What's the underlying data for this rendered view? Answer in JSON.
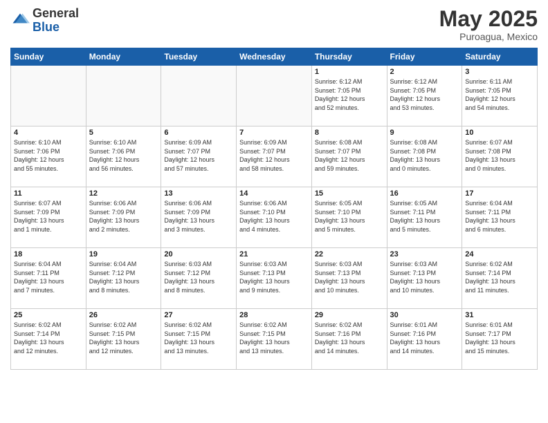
{
  "header": {
    "logo_general": "General",
    "logo_blue": "Blue",
    "title": "May 2025",
    "location": "Puroagua, Mexico"
  },
  "weekdays": [
    "Sunday",
    "Monday",
    "Tuesday",
    "Wednesday",
    "Thursday",
    "Friday",
    "Saturday"
  ],
  "weeks": [
    [
      {
        "day": "",
        "info": ""
      },
      {
        "day": "",
        "info": ""
      },
      {
        "day": "",
        "info": ""
      },
      {
        "day": "",
        "info": ""
      },
      {
        "day": "1",
        "info": "Sunrise: 6:12 AM\nSunset: 7:05 PM\nDaylight: 12 hours\nand 52 minutes."
      },
      {
        "day": "2",
        "info": "Sunrise: 6:12 AM\nSunset: 7:05 PM\nDaylight: 12 hours\nand 53 minutes."
      },
      {
        "day": "3",
        "info": "Sunrise: 6:11 AM\nSunset: 7:05 PM\nDaylight: 12 hours\nand 54 minutes."
      }
    ],
    [
      {
        "day": "4",
        "info": "Sunrise: 6:10 AM\nSunset: 7:06 PM\nDaylight: 12 hours\nand 55 minutes."
      },
      {
        "day": "5",
        "info": "Sunrise: 6:10 AM\nSunset: 7:06 PM\nDaylight: 12 hours\nand 56 minutes."
      },
      {
        "day": "6",
        "info": "Sunrise: 6:09 AM\nSunset: 7:07 PM\nDaylight: 12 hours\nand 57 minutes."
      },
      {
        "day": "7",
        "info": "Sunrise: 6:09 AM\nSunset: 7:07 PM\nDaylight: 12 hours\nand 58 minutes."
      },
      {
        "day": "8",
        "info": "Sunrise: 6:08 AM\nSunset: 7:07 PM\nDaylight: 12 hours\nand 59 minutes."
      },
      {
        "day": "9",
        "info": "Sunrise: 6:08 AM\nSunset: 7:08 PM\nDaylight: 13 hours\nand 0 minutes."
      },
      {
        "day": "10",
        "info": "Sunrise: 6:07 AM\nSunset: 7:08 PM\nDaylight: 13 hours\nand 0 minutes."
      }
    ],
    [
      {
        "day": "11",
        "info": "Sunrise: 6:07 AM\nSunset: 7:09 PM\nDaylight: 13 hours\nand 1 minute."
      },
      {
        "day": "12",
        "info": "Sunrise: 6:06 AM\nSunset: 7:09 PM\nDaylight: 13 hours\nand 2 minutes."
      },
      {
        "day": "13",
        "info": "Sunrise: 6:06 AM\nSunset: 7:09 PM\nDaylight: 13 hours\nand 3 minutes."
      },
      {
        "day": "14",
        "info": "Sunrise: 6:06 AM\nSunset: 7:10 PM\nDaylight: 13 hours\nand 4 minutes."
      },
      {
        "day": "15",
        "info": "Sunrise: 6:05 AM\nSunset: 7:10 PM\nDaylight: 13 hours\nand 5 minutes."
      },
      {
        "day": "16",
        "info": "Sunrise: 6:05 AM\nSunset: 7:11 PM\nDaylight: 13 hours\nand 5 minutes."
      },
      {
        "day": "17",
        "info": "Sunrise: 6:04 AM\nSunset: 7:11 PM\nDaylight: 13 hours\nand 6 minutes."
      }
    ],
    [
      {
        "day": "18",
        "info": "Sunrise: 6:04 AM\nSunset: 7:11 PM\nDaylight: 13 hours\nand 7 minutes."
      },
      {
        "day": "19",
        "info": "Sunrise: 6:04 AM\nSunset: 7:12 PM\nDaylight: 13 hours\nand 8 minutes."
      },
      {
        "day": "20",
        "info": "Sunrise: 6:03 AM\nSunset: 7:12 PM\nDaylight: 13 hours\nand 8 minutes."
      },
      {
        "day": "21",
        "info": "Sunrise: 6:03 AM\nSunset: 7:13 PM\nDaylight: 13 hours\nand 9 minutes."
      },
      {
        "day": "22",
        "info": "Sunrise: 6:03 AM\nSunset: 7:13 PM\nDaylight: 13 hours\nand 10 minutes."
      },
      {
        "day": "23",
        "info": "Sunrise: 6:03 AM\nSunset: 7:13 PM\nDaylight: 13 hours\nand 10 minutes."
      },
      {
        "day": "24",
        "info": "Sunrise: 6:02 AM\nSunset: 7:14 PM\nDaylight: 13 hours\nand 11 minutes."
      }
    ],
    [
      {
        "day": "25",
        "info": "Sunrise: 6:02 AM\nSunset: 7:14 PM\nDaylight: 13 hours\nand 12 minutes."
      },
      {
        "day": "26",
        "info": "Sunrise: 6:02 AM\nSunset: 7:15 PM\nDaylight: 13 hours\nand 12 minutes."
      },
      {
        "day": "27",
        "info": "Sunrise: 6:02 AM\nSunset: 7:15 PM\nDaylight: 13 hours\nand 13 minutes."
      },
      {
        "day": "28",
        "info": "Sunrise: 6:02 AM\nSunset: 7:15 PM\nDaylight: 13 hours\nand 13 minutes."
      },
      {
        "day": "29",
        "info": "Sunrise: 6:02 AM\nSunset: 7:16 PM\nDaylight: 13 hours\nand 14 minutes."
      },
      {
        "day": "30",
        "info": "Sunrise: 6:01 AM\nSunset: 7:16 PM\nDaylight: 13 hours\nand 14 minutes."
      },
      {
        "day": "31",
        "info": "Sunrise: 6:01 AM\nSunset: 7:17 PM\nDaylight: 13 hours\nand 15 minutes."
      }
    ]
  ]
}
